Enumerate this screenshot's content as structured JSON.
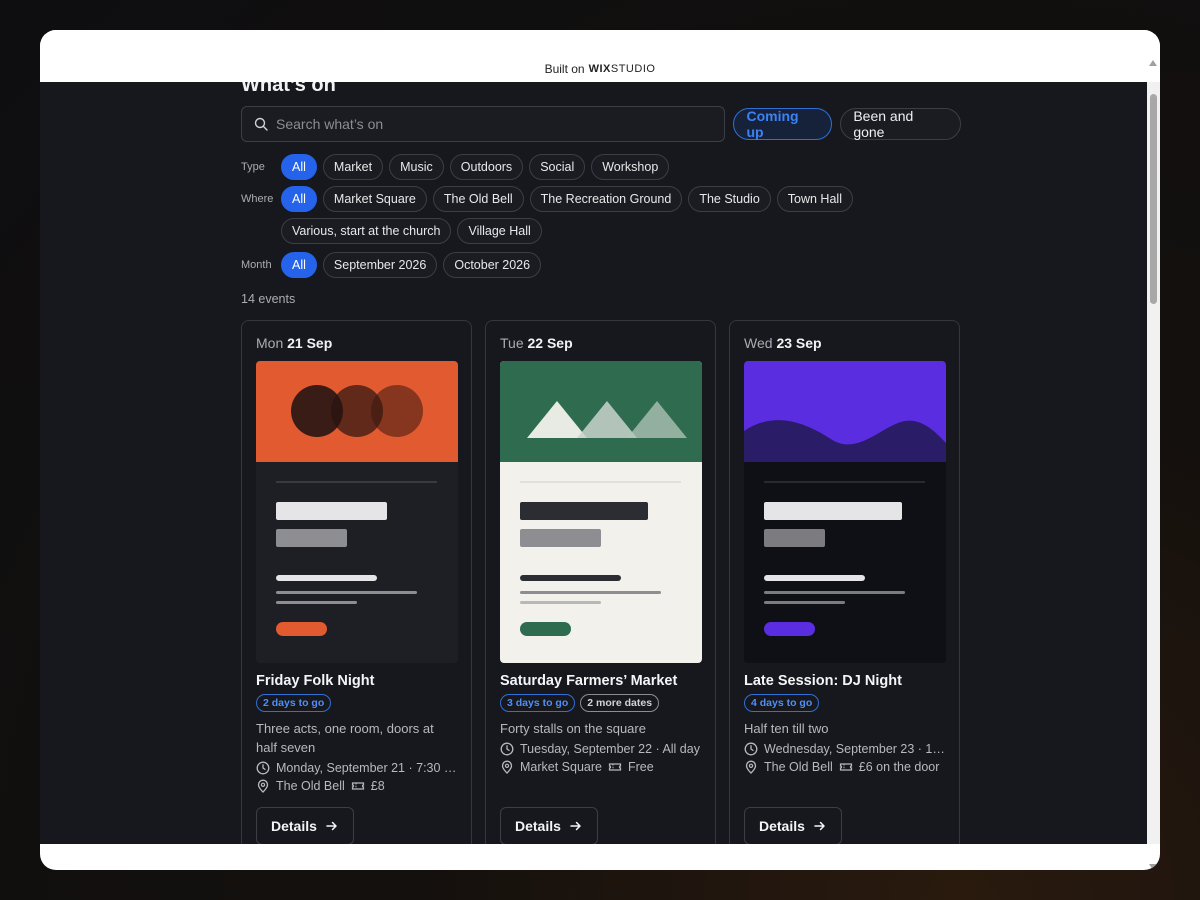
{
  "topbar": {
    "built_on": "Built on",
    "wix": "WIX",
    "studio": "STUDIO"
  },
  "page": {
    "title": "What’s on"
  },
  "search": {
    "placeholder": "Search what’s on"
  },
  "toggle": {
    "coming_up": "Coming up",
    "been_and_gone": "Been and gone"
  },
  "filters": {
    "type": {
      "label": "Type",
      "options": [
        "All",
        "Market",
        "Music",
        "Outdoors",
        "Social",
        "Workshop"
      ]
    },
    "where": {
      "label": "Where",
      "options": [
        "All",
        "Market Square",
        "The Old Bell",
        "The Recreation Ground",
        "The Studio",
        "Town Hall",
        "Various, start at the church",
        "Village Hall"
      ]
    },
    "month": {
      "label": "Month",
      "options": [
        "All",
        "September 2026",
        "October 2026"
      ]
    }
  },
  "count": "14 events",
  "colors": {
    "accent": "#2563eb",
    "orange": "#e25a30",
    "green": "#2e6b4f",
    "purple": "#5b2de0"
  },
  "events": [
    {
      "weekday": "Mon",
      "day": "21",
      "month": "Sep",
      "title": "Friday Folk Night",
      "badge": "2 days to go",
      "desc": "Three acts, one room, doors at half seven",
      "when": "Monday, September 21 · 7:30 P...",
      "where": "The Old Bell",
      "price": "£8",
      "details": "Details"
    },
    {
      "weekday": "Tue",
      "day": "22",
      "month": "Sep",
      "title": "Saturday Farmers’ Market",
      "badge": "3 days to go",
      "badge2": "2 more dates",
      "desc": "Forty stalls on the square",
      "when": "Tuesday, September 22 · All day",
      "where": "Market Square",
      "price": "Free",
      "details": "Details"
    },
    {
      "weekday": "Wed",
      "day": "23",
      "month": "Sep",
      "title": "Late Session: DJ Night",
      "badge": "4 days to go",
      "desc": "Half ten till two",
      "when": "Wednesday, September 23 · 10...",
      "where": "The Old Bell",
      "price": "£6 on the door",
      "details": "Details"
    }
  ]
}
